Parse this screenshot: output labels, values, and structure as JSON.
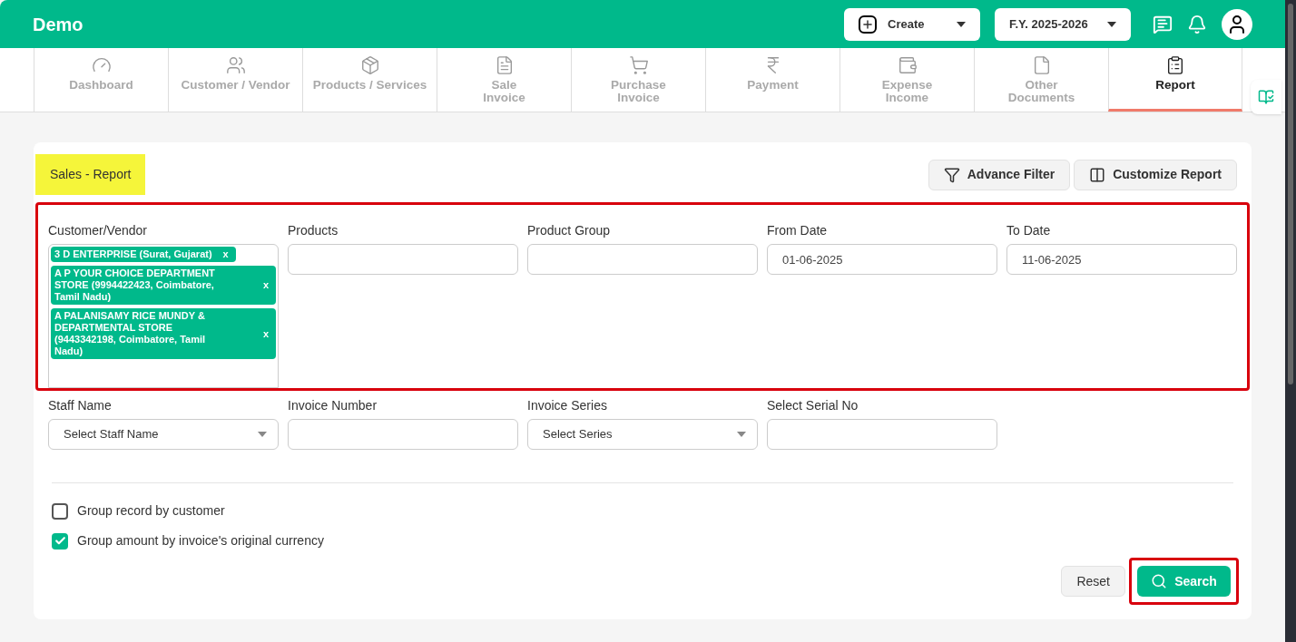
{
  "header": {
    "brand": "Demo",
    "create_button": "Create",
    "fiscal_year": "F.Y. 2025-2026"
  },
  "tabs": [
    {
      "label": "Dashboard",
      "selected": false
    },
    {
      "label": "Customer / Vendor",
      "selected": false
    },
    {
      "label": "Products / Services",
      "selected": false
    },
    {
      "label": "Sale\nInvoice",
      "selected": false
    },
    {
      "label": "Purchase\nInvoice",
      "selected": false
    },
    {
      "label": "Payment",
      "selected": false
    },
    {
      "label": "Expense\nIncome",
      "selected": false
    },
    {
      "label": "Other\nDocuments",
      "selected": false
    },
    {
      "label": "Report",
      "selected": true
    }
  ],
  "report": {
    "title": "Sales - Report",
    "actions": [
      {
        "label": "Advance Filter"
      },
      {
        "label": "Customize Report"
      }
    ],
    "customer_field": {
      "label": "Customer/Vendor",
      "tags": [
        {
          "text": "3 D ENTERPRISE (Surat, Gujarat)",
          "remove": "x"
        },
        {
          "text": "A P YOUR CHOICE DEPARTMENT STORE (9994422423, Coimbatore, Tamil Nadu)",
          "remove": "x"
        },
        {
          "text": "A PALANISAMY RICE MUNDY & DEPARTMENTAL STORE (9443342198, Coimbatore, Tamil Nadu)",
          "remove": "x"
        }
      ]
    },
    "top_fields": [
      {
        "label": "Products"
      },
      {
        "label": "Product Group"
      },
      {
        "label": "From Date",
        "value": "01-06-2025"
      },
      {
        "label": "To Date",
        "value": "11-06-2025"
      }
    ],
    "bottom_fields": [
      {
        "label": "Staff Name",
        "kind": "select",
        "value": "Select Staff Name"
      },
      {
        "label": "Invoice Number",
        "kind": "text"
      },
      {
        "label": "Invoice Series",
        "kind": "select",
        "value": "Select Series"
      },
      {
        "label": "Select Serial No",
        "kind": "text"
      }
    ],
    "options": [
      {
        "label": "Group record by customer",
        "checked": false
      },
      {
        "label": "Group amount by invoice's original currency",
        "checked": true
      }
    ],
    "reset_button": "Reset",
    "search_button": "Search"
  }
}
